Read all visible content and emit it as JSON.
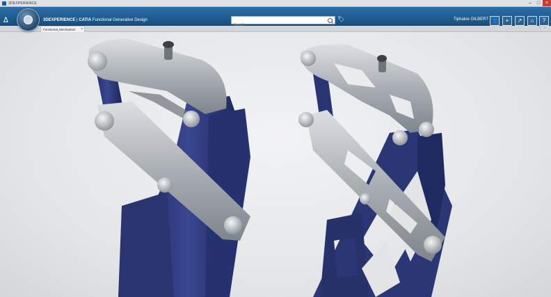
{
  "window": {
    "title": "3DEXPERIENCE",
    "minimize": "–",
    "maximize": "□",
    "close": "×"
  },
  "appbar": {
    "brand_prefix": "3DEXPERIENCE",
    "brand_sep": " | ",
    "brand_product": "CATIA",
    "brand_app": " Functional Generative Design",
    "search_placeholder": "Search",
    "tag_icon": "🏷",
    "user": "Tiphaine GILBERT",
    "icons": [
      "user-icon",
      "plus-icon",
      "share-icon",
      "home-icon",
      "help-icon"
    ]
  },
  "tabs": {
    "active_label": "Functional_Mechanism",
    "close": "×",
    "nav": "‹ ›"
  },
  "colors": {
    "appbar": "#1d5a8e",
    "navy_part": "#2c3775",
    "metal_part": "#b9bdc2"
  }
}
